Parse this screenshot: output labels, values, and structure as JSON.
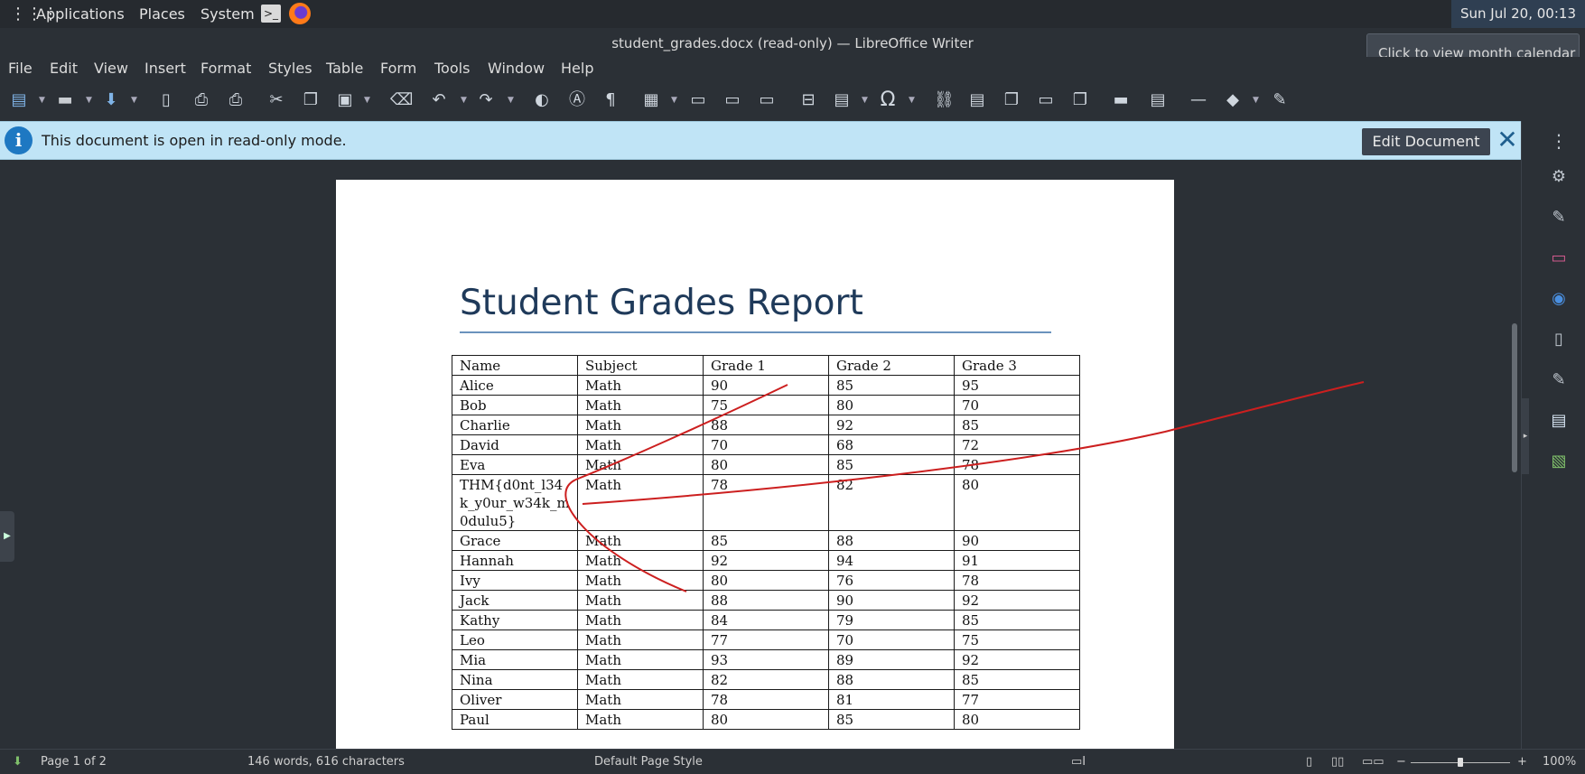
{
  "panel": {
    "apps_label": "Applications",
    "places_label": "Places",
    "system_label": "System",
    "clock": "Sun Jul 20, 00:13"
  },
  "window": {
    "title": "student_grades.docx (read-only) — LibreOffice Writer",
    "tooltip": "Click to view month calendar"
  },
  "menu": [
    "File",
    "Edit",
    "View",
    "Insert",
    "Format",
    "Styles",
    "Table",
    "Form",
    "Tools",
    "Window",
    "Help"
  ],
  "infobar": {
    "message": "This document is open in read-only mode.",
    "edit_label": "Edit Document",
    "close_glyph": "✕"
  },
  "document": {
    "title": "Student Grades Report",
    "table": {
      "headers": [
        "Name",
        "Subject",
        "Grade 1",
        "Grade 2",
        "Grade 3"
      ],
      "rows": [
        [
          "Alice",
          "Math",
          "90",
          "85",
          "95"
        ],
        [
          "Bob",
          "Math",
          "75",
          "80",
          "70"
        ],
        [
          "Charlie",
          "Math",
          "88",
          "92",
          "85"
        ],
        [
          "David",
          "Math",
          "70",
          "68",
          "72"
        ],
        [
          "Eva",
          "Math",
          "80",
          "85",
          "78"
        ],
        [
          "THM{d0nt_l34k_y0ur_w34k_m0dulu5}",
          "Math",
          "78",
          "82",
          "80"
        ],
        [
          "Grace",
          "Math",
          "85",
          "88",
          "90"
        ],
        [
          "Hannah",
          "Math",
          "92",
          "94",
          "91"
        ],
        [
          "Ivy",
          "Math",
          "80",
          "76",
          "78"
        ],
        [
          "Jack",
          "Math",
          "88",
          "90",
          "92"
        ],
        [
          "Kathy",
          "Math",
          "84",
          "79",
          "85"
        ],
        [
          "Leo",
          "Math",
          "77",
          "70",
          "75"
        ],
        [
          "Mia",
          "Math",
          "93",
          "89",
          "92"
        ],
        [
          "Nina",
          "Math",
          "82",
          "88",
          "85"
        ],
        [
          "Oliver",
          "Math",
          "78",
          "81",
          "77"
        ],
        [
          "Paul",
          "Math",
          "80",
          "85",
          "80"
        ]
      ]
    }
  },
  "status": {
    "page": "Page 1 of 2",
    "words": "146 words, 616 characters",
    "page_style": "Default Page Style",
    "zoom_minus": "−",
    "zoom_plus": "+",
    "zoom": "100%"
  },
  "colors": {
    "infobar_bg": "#c0e4f6",
    "annotation_stroke": "#cc1f1f",
    "title_color": "#1f3a5a"
  }
}
